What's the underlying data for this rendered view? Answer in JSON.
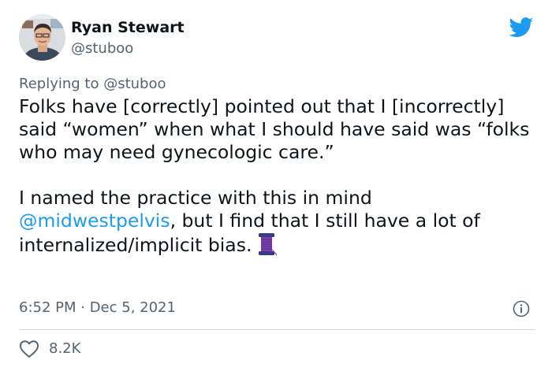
{
  "author": {
    "name": "Ryan Stewart",
    "handle": "@stuboo"
  },
  "reply": {
    "prefix": "Replying to ",
    "to": "@stuboo"
  },
  "tweet": {
    "para1": "Folks have [correctly] pointed out that I [incorrectly] said “women” when what I should have said was “folks who may need gynecologic care.”",
    "para2_start": "I named the practice with this in mind ",
    "mention": "@midwestpelvis",
    "para2_end": ", but I find that I still have a lot of internalized/implicit bias.",
    "emoji": "thread-spool-emoji"
  },
  "meta": {
    "timestamp": "6:52 PM · Dec 5, 2021"
  },
  "actions": {
    "like_count": "8.2K"
  },
  "icons": {
    "brand": "twitter-bird-icon",
    "info": "info-icon",
    "like": "heart-icon"
  },
  "colors": {
    "twitter_blue": "#1d9bf0",
    "secondary_text": "#536471",
    "primary_text": "#0f1419"
  }
}
